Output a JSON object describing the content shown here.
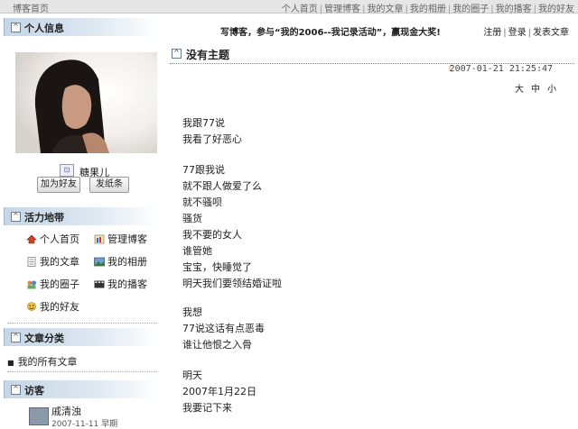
{
  "topbar": {
    "home": "博客首页",
    "links": [
      "个人首页",
      "管理博客",
      "我的文章",
      "我的相册",
      "我的圈子",
      "我的播客",
      "我的好友"
    ]
  },
  "sidebar": {
    "profile": {
      "header": "个人信息",
      "username": "糖果儿",
      "add_friend": "加为好友",
      "send_note": "发纸条"
    },
    "activity": {
      "header": "活力地带",
      "items": [
        "个人首页",
        "管理博客",
        "我的文章",
        "我的相册",
        "我的圈子",
        "我的播客",
        "我的好友"
      ]
    },
    "categories": {
      "header": "文章分类",
      "items": [
        "我的所有文章"
      ]
    },
    "visitors": {
      "header": "访客",
      "items": [
        {
          "name": "戚清浊",
          "date": "2007-11-11 早期"
        }
      ]
    }
  },
  "main": {
    "announcement": "写博客，参与“我的2006--我记录活动”，赢现金大奖!",
    "actions": [
      "注册",
      "登录",
      "发表文章"
    ],
    "post": {
      "title": "没有主题",
      "datetime": "2007-01-21 21:25:47",
      "font_sizes": [
        "大",
        "中",
        "小"
      ],
      "lines": [
        "我跟77说",
        "我看了好恶心",
        "",
        "77跟我说",
        "就不跟人做爱了么",
        "就不骚呗",
        "骚货",
        "我不要的女人",
        "谁管她",
        "宝宝，快睡觉了",
        "明天我们要领结婚证啦",
        "",
        "我想",
        "77说这话有点恶毒",
        "谁让他恨之入骨",
        "",
        "明天",
        "2007年1月22日",
        "我要记下来"
      ]
    }
  },
  "colors": {
    "section_header": "#c5d6e6",
    "topbar": "#e6e6e6"
  },
  "icons": [
    "collapse-box-icon",
    "user-card-icon",
    "home-icon",
    "manage-icon",
    "article-icon",
    "album-icon",
    "circle-icon",
    "podcast-icon",
    "friends-icon",
    "moon-icon"
  ]
}
